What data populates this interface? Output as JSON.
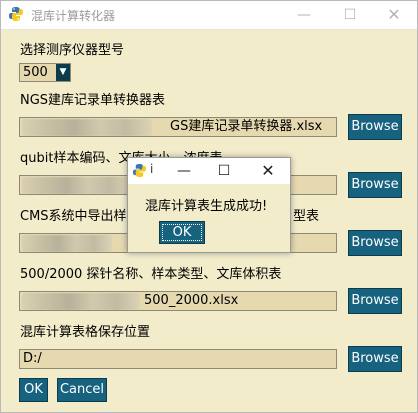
{
  "window": {
    "title": "混库计算转化器",
    "controls": {
      "minimize": "—",
      "maximize": "☐",
      "close": "✕"
    }
  },
  "instrument": {
    "label": "选择测序仪器型号",
    "selected": "500"
  },
  "ngs": {
    "label": "NGS建库记录单转换器表",
    "path_visible": "GS建库记录单转换器.xlsx",
    "browse": "Browse"
  },
  "qubit": {
    "label": "qubit样本编码、文库大小、浓度表",
    "path_visible": "",
    "browse": "Browse"
  },
  "cms": {
    "label": "CMS系统中导出样",
    "label_tail": "型表",
    "path_visible": "",
    "browse": "Browse"
  },
  "probe": {
    "label": "500/2000 探针名称、样本类型、文库体积表",
    "path_visible": "500_2000.xlsx",
    "browse": "Browse"
  },
  "save": {
    "label": "混库计算表格保存位置",
    "path": "D:/",
    "browse": "Browse"
  },
  "footer": {
    "ok": "OK",
    "cancel": "Cancel"
  },
  "dialog": {
    "title_mark": "i",
    "controls": {
      "minimize": "—",
      "maximize": "☐",
      "close": "✕"
    },
    "message": "混库计算表生成成功!",
    "ok": "OK"
  },
  "colors": {
    "background": "#f2eccb",
    "entry": "#e6d9b0",
    "button": "#17627f"
  }
}
